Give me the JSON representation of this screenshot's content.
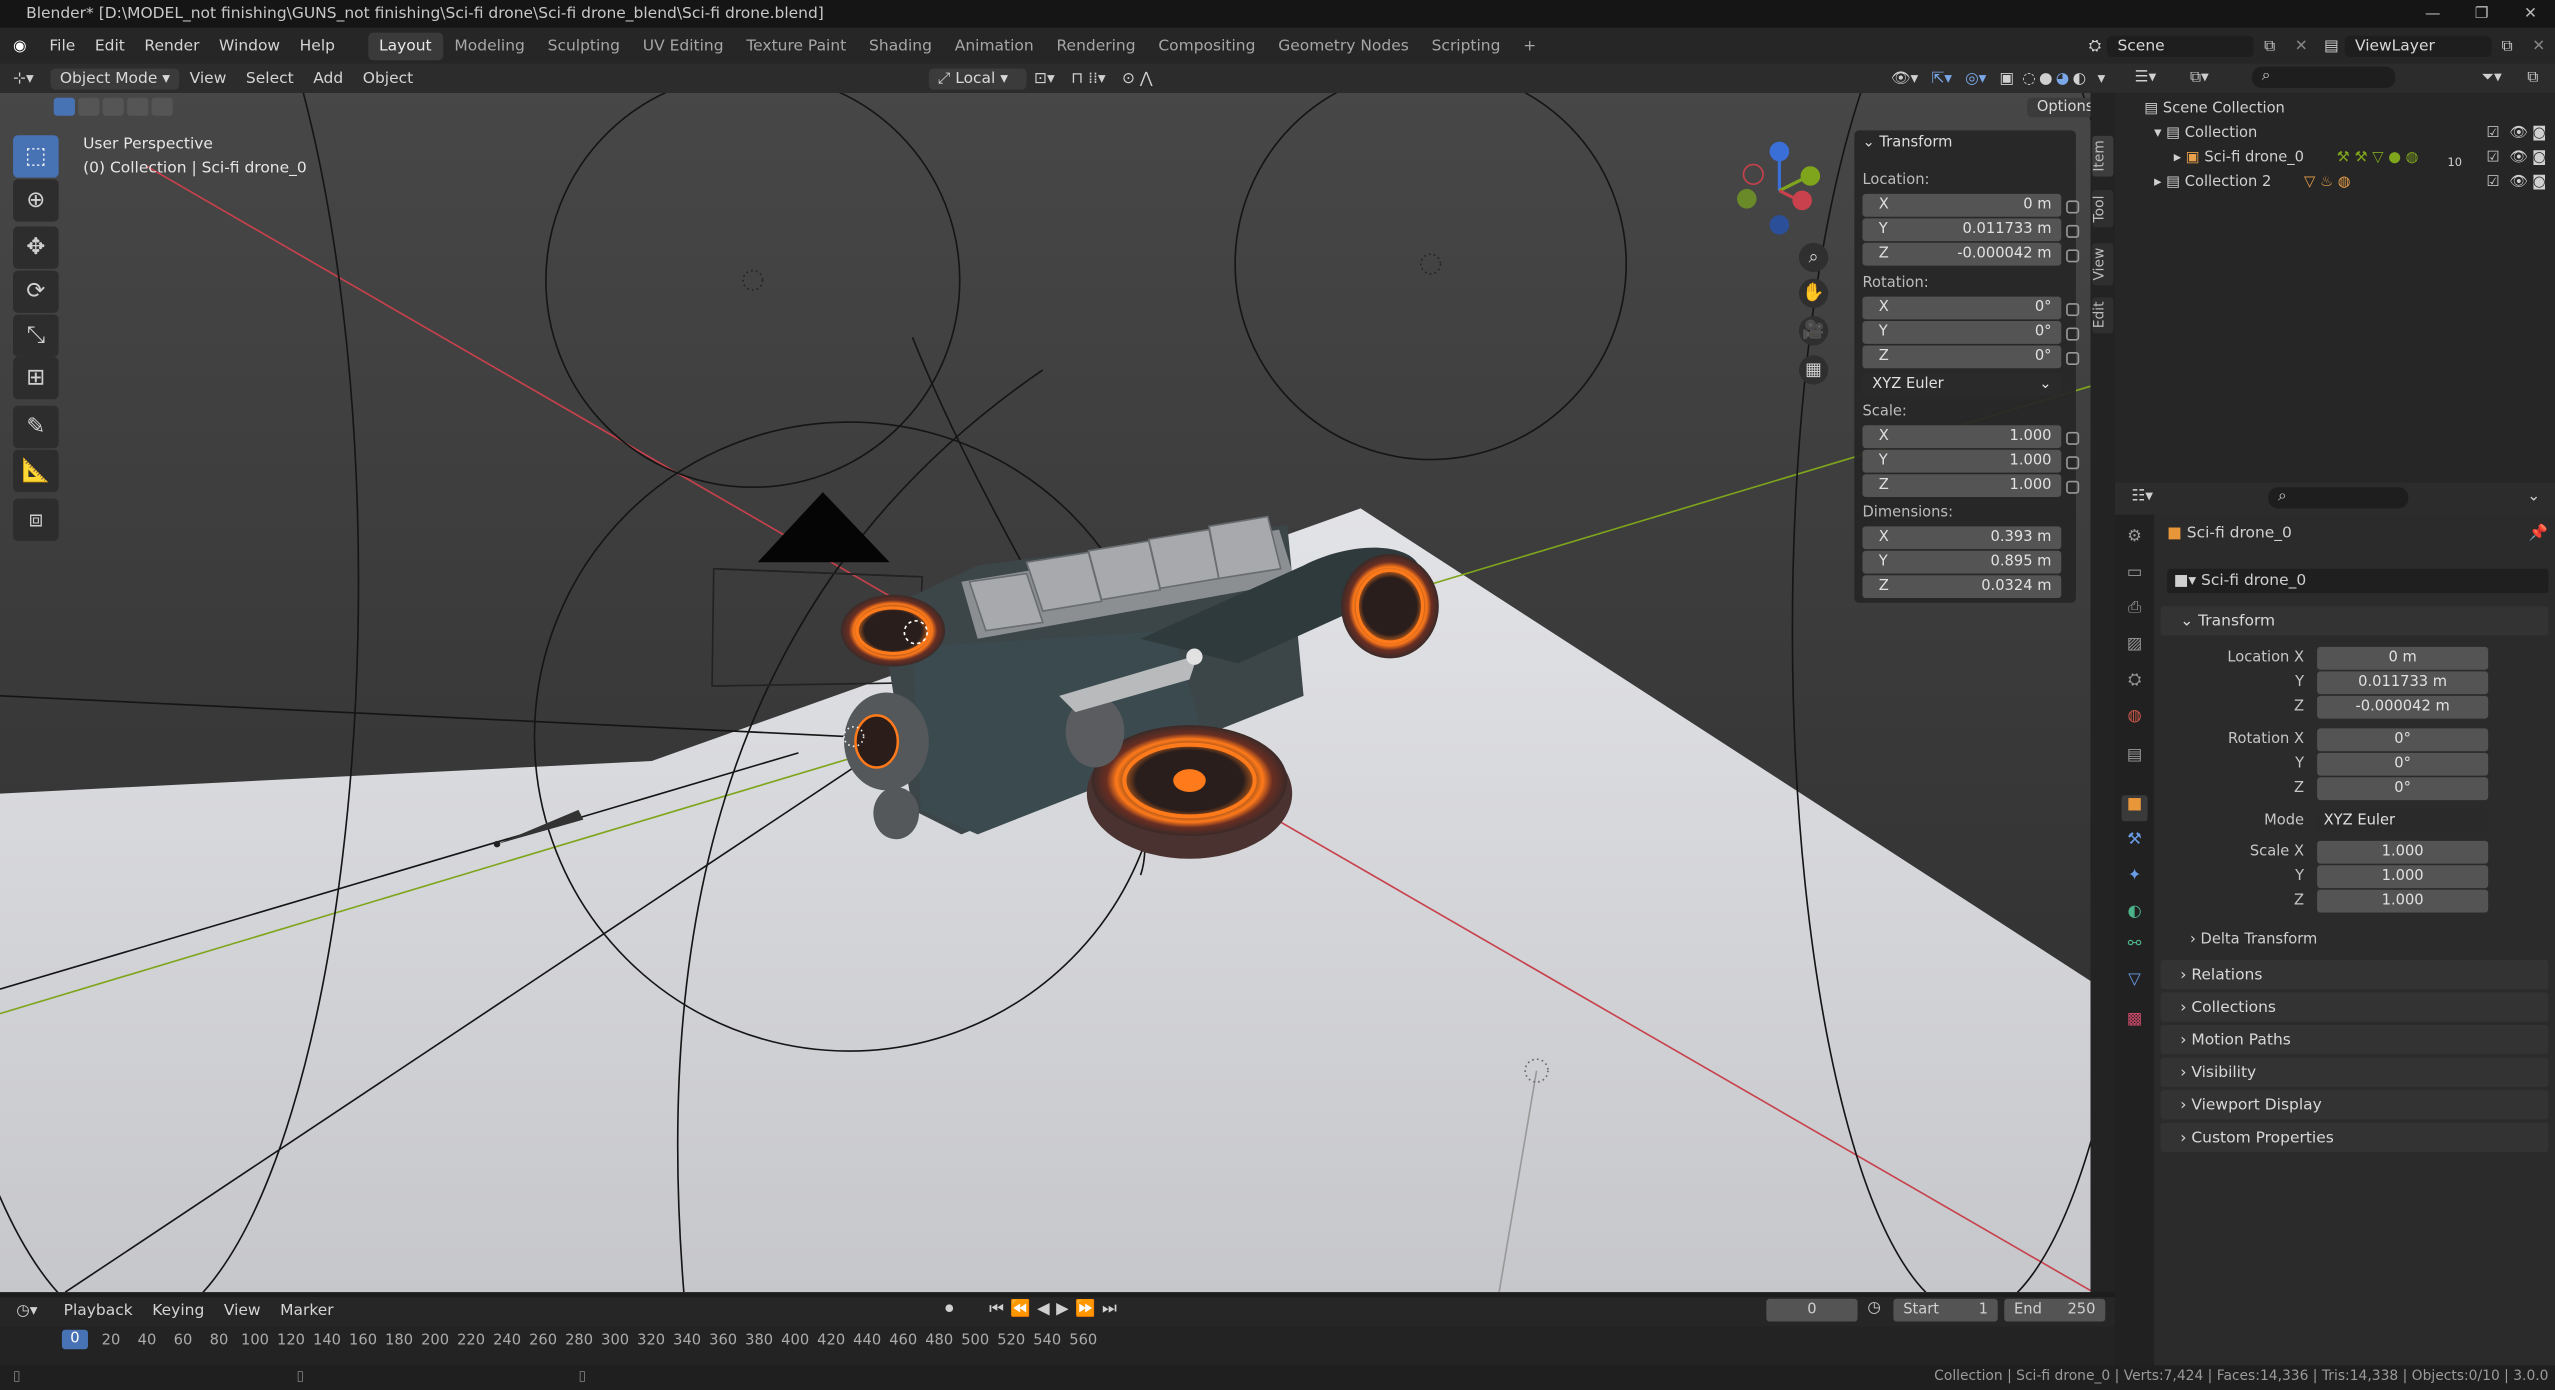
{
  "title": "Blender* [D:\\MODEL_not finishing\\GUNS_not finishing\\Sci-fi drone\\Sci-fi drone_blend\\Sci-fi drone.blend]",
  "menu": [
    "File",
    "Edit",
    "Render",
    "Window",
    "Help"
  ],
  "workspaces": [
    "Layout",
    "Modeling",
    "Sculpting",
    "UV Editing",
    "Texture Paint",
    "Shading",
    "Animation",
    "Rendering",
    "Compositing",
    "Geometry Nodes",
    "Scripting",
    "+"
  ],
  "scene_label": "Scene",
  "viewlayer_label": "ViewLayer",
  "viewport_header": {
    "mode": "Object Mode",
    "menus": [
      "View",
      "Select",
      "Add",
      "Object"
    ],
    "orientation": "Local",
    "options": "Options"
  },
  "viewport": {
    "perspective": "User Perspective",
    "collection": "(0) Collection | Sci-fi drone_0"
  },
  "npanel": {
    "title": "Transform",
    "location_label": "Location:",
    "location": [
      {
        "axis": "X",
        "value": "0 m"
      },
      {
        "axis": "Y",
        "value": "0.011733 m"
      },
      {
        "axis": "Z",
        "value": "-0.000042 m"
      }
    ],
    "rotation_label": "Rotation:",
    "rotation": [
      {
        "axis": "X",
        "value": "0°"
      },
      {
        "axis": "Y",
        "value": "0°"
      },
      {
        "axis": "Z",
        "value": "0°"
      }
    ],
    "rotation_mode": "XYZ Euler",
    "scale_label": "Scale:",
    "scale": [
      {
        "axis": "X",
        "value": "1.000"
      },
      {
        "axis": "Y",
        "value": "1.000"
      },
      {
        "axis": "Z",
        "value": "1.000"
      }
    ],
    "dimensions_label": "Dimensions:",
    "dimensions": [
      {
        "axis": "X",
        "value": "0.393 m"
      },
      {
        "axis": "Y",
        "value": "0.895 m"
      },
      {
        "axis": "Z",
        "value": "0.0324 m"
      }
    ]
  },
  "side_tabs": [
    "Item",
    "Tool",
    "View",
    "Edit"
  ],
  "outliner": {
    "root": "Scene Collection",
    "collection": "Collection",
    "object": "Sci-fi drone_0",
    "collection2": "Collection 2",
    "badge": "10"
  },
  "properties": {
    "object_name": "Sci-fi drone_0",
    "data_name": "Sci-fi drone_0",
    "transform": "Transform",
    "location_x_label": "Location X",
    "loc": [
      "0 m",
      "0.011733 m",
      "-0.000042 m"
    ],
    "rotation_x_label": "Rotation X",
    "rot": [
      "0°",
      "0°",
      "0°"
    ],
    "mode_label": "Mode",
    "mode": "XYZ Euler",
    "scale_x_label": "Scale X",
    "scale": [
      "1.000",
      "1.000",
      "1.000"
    ],
    "y": "Y",
    "z": "Z",
    "delta": "Delta Transform",
    "sections": [
      "Relations",
      "Collections",
      "Motion Paths",
      "Visibility",
      "Viewport Display",
      "Custom Properties"
    ]
  },
  "timeline": {
    "menus": [
      "Playback",
      "Keying",
      "View",
      "Marker"
    ],
    "current_frame": "0",
    "start_label": "Start",
    "start": "1",
    "end_label": "End",
    "end": "250",
    "ticks": [
      "0",
      "20",
      "40",
      "60",
      "80",
      "100",
      "120",
      "140",
      "160",
      "180",
      "200",
      "220",
      "240",
      "260",
      "280",
      "300",
      "320",
      "340",
      "360",
      "380",
      "400",
      "420",
      "440",
      "460",
      "480",
      "500",
      "520",
      "540",
      "560"
    ]
  },
  "status": "Collection | Sci-fi drone_0 | Verts:7,424 | Faces:14,336 | Tris:14,338 | Objects:0/10 | 3.0.0",
  "colors": {
    "accent": "#4772b3",
    "x_axis": "#c8414c",
    "y_axis": "#7fa51c",
    "z_axis": "#3a6fd8",
    "glow": "#ff7a1a"
  }
}
